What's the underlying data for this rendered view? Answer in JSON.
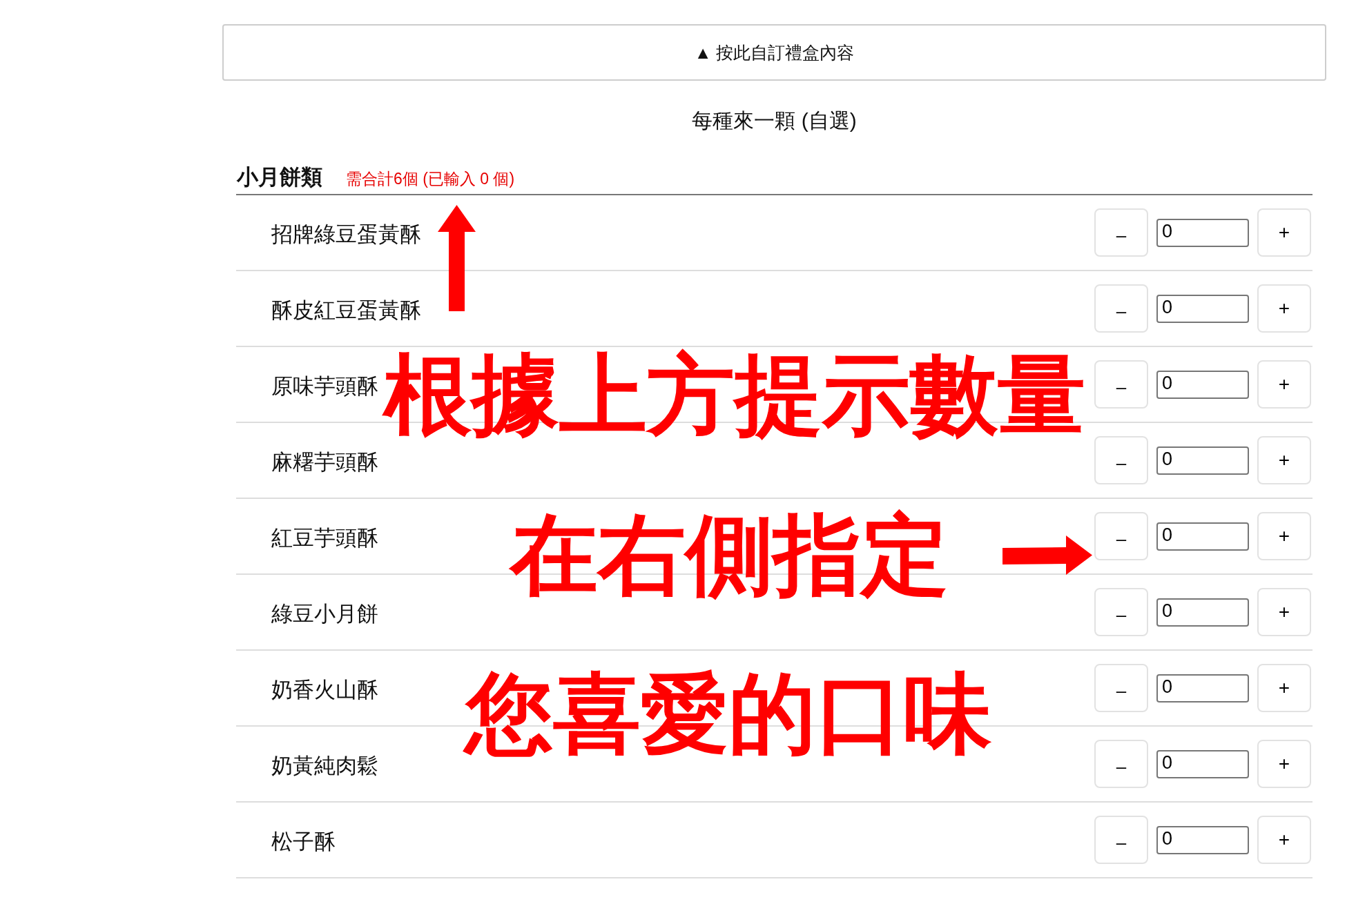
{
  "customize_button": {
    "label": "▲ 按此自訂禮盒內容"
  },
  "option_title": "每種來一顆 (自選)",
  "category": {
    "title": "小月餅類",
    "requirement": "需合計6個 (已輸入 0 個)",
    "items": [
      {
        "name": "招牌綠豆蛋黃酥",
        "minus_label": "–",
        "quantity": "0",
        "plus_label": "+"
      },
      {
        "name": "酥皮紅豆蛋黃酥",
        "minus_label": "–",
        "quantity": "0",
        "plus_label": "+"
      },
      {
        "name": "原味芋頭酥",
        "minus_label": "–",
        "quantity": "0",
        "plus_label": "+"
      },
      {
        "name": "麻糬芋頭酥",
        "minus_label": "–",
        "quantity": "0",
        "plus_label": "+"
      },
      {
        "name": "紅豆芋頭酥",
        "minus_label": "–",
        "quantity": "0",
        "plus_label": "+"
      },
      {
        "name": "綠豆小月餅",
        "minus_label": "–",
        "quantity": "0",
        "plus_label": "+"
      },
      {
        "name": "奶香火山酥",
        "minus_label": "–",
        "quantity": "0",
        "plus_label": "+"
      },
      {
        "name": "奶黃純肉鬆",
        "minus_label": "–",
        "quantity": "0",
        "plus_label": "+"
      },
      {
        "name": "松子酥",
        "minus_label": "–",
        "quantity": "0",
        "plus_label": "+"
      }
    ]
  },
  "annotation": {
    "lines": [
      "根據上方提示數量",
      "在右側指定",
      "您喜愛的口味"
    ]
  }
}
